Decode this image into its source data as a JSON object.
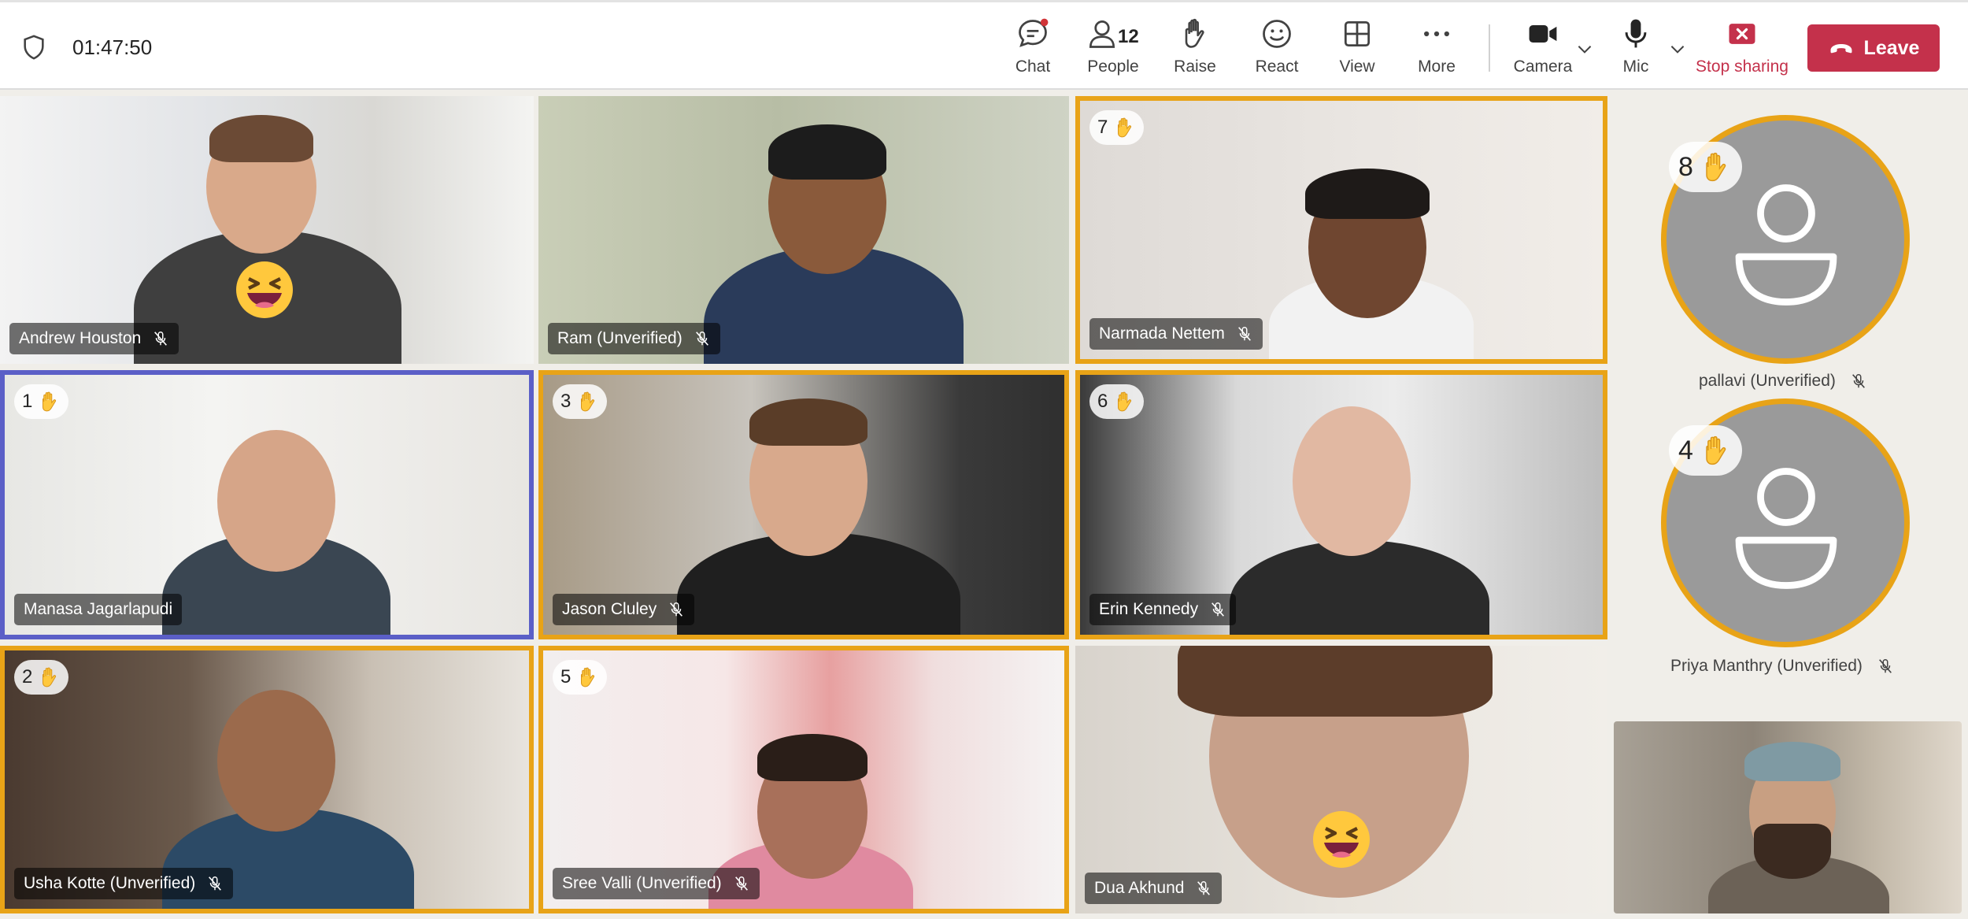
{
  "meeting": {
    "timer": "01:47:50"
  },
  "toolbar": {
    "chat": "Chat",
    "people": "People",
    "people_count": "12",
    "raise": "Raise",
    "react": "React",
    "view": "View",
    "more": "More",
    "camera": "Camera",
    "mic": "Mic",
    "stop_sharing": "Stop sharing",
    "leave": "Leave"
  },
  "colors": {
    "raised_hand_border": "#e8a317",
    "active_speaker_border": "#5b5fc7",
    "leave_button": "#c4314b",
    "stop_sharing": "#c4314b"
  },
  "participants": [
    {
      "name": "Andrew Houston",
      "muted": true,
      "reaction": "laughing"
    },
    {
      "name": "Ram (Unverified)",
      "muted": true
    },
    {
      "name": "Narmada Nettem",
      "muted": true,
      "hand_order": "7"
    },
    {
      "name": "Manasa Jagarlapudi",
      "muted": false,
      "hand_order": "1",
      "active_speaker": true
    },
    {
      "name": "Jason Cluley",
      "muted": true,
      "hand_order": "3"
    },
    {
      "name": "Erin Kennedy",
      "muted": true,
      "hand_order": "6"
    },
    {
      "name": "Usha Kotte (Unverified)",
      "muted": true,
      "hand_order": "2"
    },
    {
      "name": "Sree Valli (Unverified)",
      "muted": true,
      "hand_order": "5"
    },
    {
      "name": "Dua Akhund",
      "muted": true,
      "reaction": "laughing"
    }
  ],
  "side_panel": [
    {
      "name": "pallavi (Unverified)",
      "muted": true,
      "hand_order": "8"
    },
    {
      "name": "Priya Manthry (Unverified)",
      "muted": true,
      "hand_order": "4"
    }
  ]
}
